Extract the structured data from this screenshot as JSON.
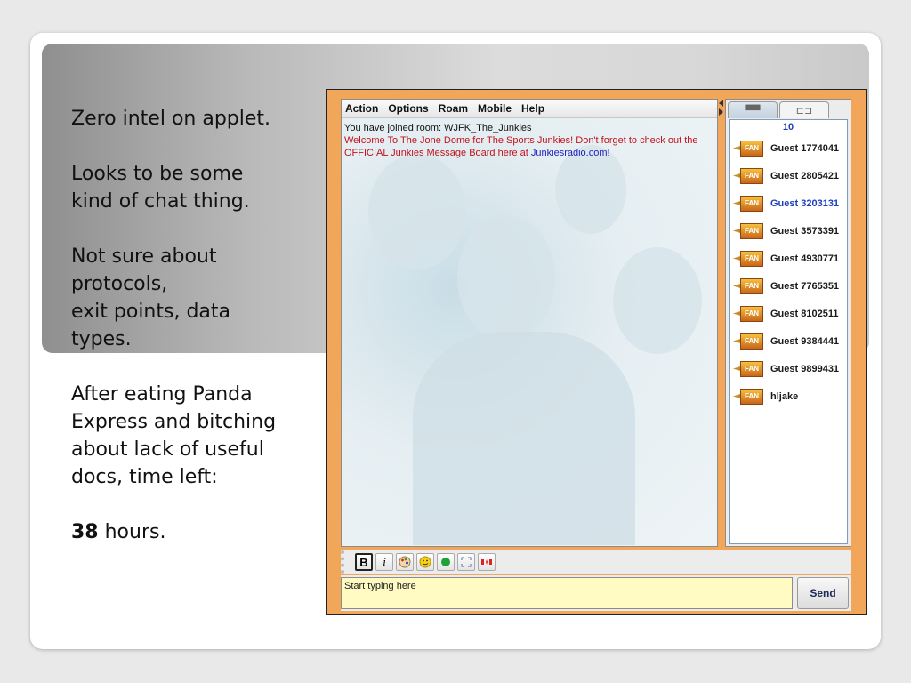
{
  "notes": {
    "line1": "Zero intel on applet.",
    "line2a": "Looks to be some",
    "line2b": "kind of chat thing.",
    "line3a": "Not sure about",
    "line3b": "protocols,",
    "line3c": "exit points, data",
    "line3d": "types.",
    "line4a": "After eating Panda",
    "line4b": "Express and bitching",
    "line4c": "about lack of useful",
    "line4d": "docs, time left:",
    "hours_value": "38",
    "hours_label": " hours."
  },
  "applet": {
    "menu": [
      "Action",
      "Options",
      "Roam",
      "Mobile",
      "Help"
    ],
    "messages": {
      "joined": "You have joined room: WJFK_The_Junkies",
      "welcome": "Welcome To The Jone Dome for The Sports Junkies! Don't forget to check out the OFFICIAL Junkies Message Board here at ",
      "link": "Junkiesradio.com!"
    },
    "users": {
      "count": "10",
      "badge_text": "FAN",
      "list": [
        {
          "name": "Guest 1774041",
          "selected": false
        },
        {
          "name": "Guest 2805421",
          "selected": false
        },
        {
          "name": "Guest 3203131",
          "selected": true
        },
        {
          "name": "Guest 3573391",
          "selected": false
        },
        {
          "name": "Guest 4930771",
          "selected": false
        },
        {
          "name": "Guest 7765351",
          "selected": false
        },
        {
          "name": "Guest 8102511",
          "selected": false
        },
        {
          "name": "Guest 9384441",
          "selected": false
        },
        {
          "name": "Guest 9899431",
          "selected": false
        },
        {
          "name": "hljake",
          "selected": false
        }
      ]
    },
    "toolbar": {
      "bold_label": "B",
      "italic_label": "i",
      "icons": [
        "palette-icon",
        "smiley-icon",
        "status-green-icon",
        "expand-icon",
        "flag-icon"
      ]
    },
    "input": {
      "placeholder": "Start typing here"
    },
    "send_label": "Send"
  },
  "colors": {
    "applet_border": "#f2a65a",
    "welcome_text": "#c1121c",
    "selected_user": "#1b3fc0",
    "input_bg": "#fffbc2"
  }
}
